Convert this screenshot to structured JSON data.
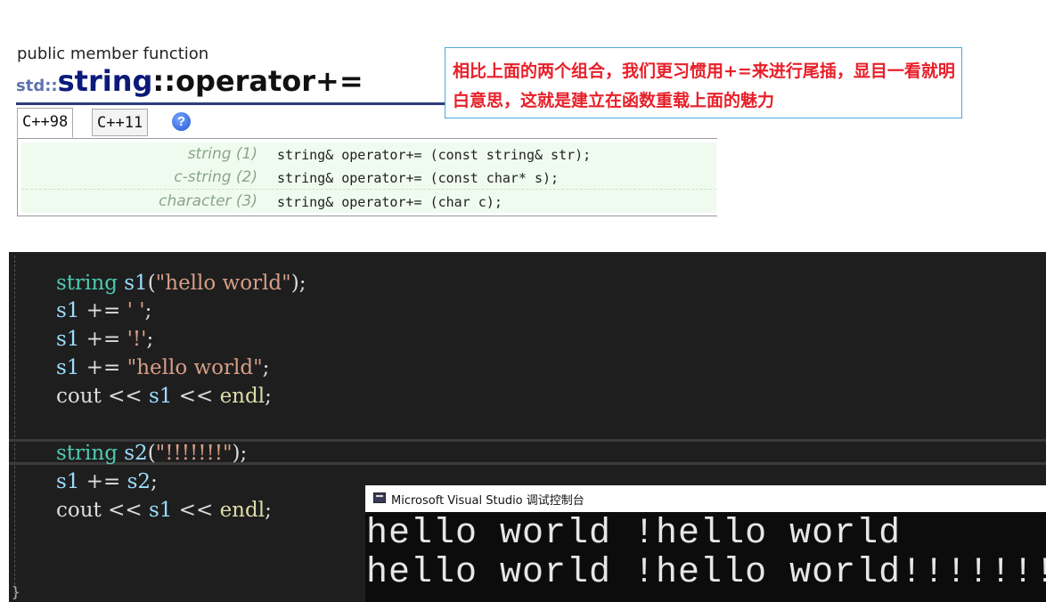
{
  "doc": {
    "kicker": "public member function",
    "ns": "std::",
    "class_name": "string",
    "op_name": "::operator+=",
    "tabs": [
      "C++98",
      "C++11"
    ],
    "help_glyph": "?",
    "signatures": [
      {
        "label": "string (1)",
        "code": "string& operator+= (const string& str);"
      },
      {
        "label": "c-string (2)",
        "code": "string& operator+= (const char* s);"
      },
      {
        "label": "character (3)",
        "code": "string& operator+= (char c);"
      }
    ]
  },
  "note": {
    "text": "相比上面的两个组合，我们更习惯用+=来进行尾插，显目一看就明白意思，这就是建立在函数重载上面的魅力",
    "color": "#e8202a"
  },
  "editor": {
    "lines": [
      [
        [
          "k",
          "string"
        ],
        [
          "p",
          " "
        ],
        [
          "v",
          "s1"
        ],
        [
          "p",
          "("
        ],
        [
          "s",
          "\"hello world\""
        ],
        [
          "p",
          ");"
        ]
      ],
      [
        [
          "v",
          "s1"
        ],
        [
          "p",
          " += "
        ],
        [
          "s",
          "' '"
        ],
        [
          "p",
          ";"
        ]
      ],
      [
        [
          "v",
          "s1"
        ],
        [
          "p",
          " += "
        ],
        [
          "s",
          "'!'"
        ],
        [
          "p",
          ";"
        ]
      ],
      [
        [
          "v",
          "s1"
        ],
        [
          "p",
          " += "
        ],
        [
          "s",
          "\"hello world\""
        ],
        [
          "p",
          ";"
        ]
      ],
      [
        [
          "p",
          "cout << "
        ],
        [
          "v",
          "s1"
        ],
        [
          "p",
          " << "
        ],
        [
          "f",
          "endl"
        ],
        [
          "p",
          ";"
        ]
      ],
      [],
      [
        [
          "k",
          "string"
        ],
        [
          "p",
          " "
        ],
        [
          "v",
          "s2"
        ],
        [
          "p",
          "("
        ],
        [
          "s",
          "\"!!!!!!!\""
        ],
        [
          "p",
          ");"
        ]
      ],
      [
        [
          "v",
          "s1"
        ],
        [
          "p",
          " += "
        ],
        [
          "v",
          "s2"
        ],
        [
          "p",
          ";"
        ]
      ],
      [
        [
          "p",
          "cout << "
        ],
        [
          "v",
          "s1"
        ],
        [
          "p",
          " << "
        ],
        [
          "f",
          "endl"
        ],
        [
          "p",
          ";"
        ]
      ]
    ],
    "closing_brace": "}"
  },
  "console": {
    "title": "Microsoft Visual Studio 调试控制台",
    "output": [
      "hello world !hello world",
      "hello world !hello world!!!!!!!"
    ]
  }
}
